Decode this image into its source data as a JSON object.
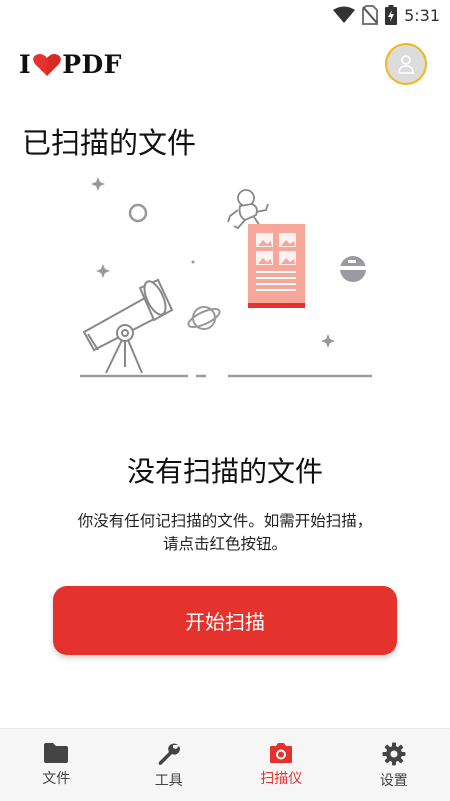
{
  "status_bar": {
    "time": "5:31"
  },
  "app": {
    "logo_text": "PDF",
    "logo_prefix": "I"
  },
  "page": {
    "title": "已扫描的文件"
  },
  "empty_state": {
    "title": "没有扫描的文件",
    "description_line1": "你没有任何记扫描的文件。如需开始扫描，",
    "description_line2": "请点击红色按钮。"
  },
  "actions": {
    "start_scan_label": "开始扫描"
  },
  "nav": {
    "items": [
      {
        "label": "文件",
        "icon": "folder-icon",
        "active": false
      },
      {
        "label": "工具",
        "icon": "wrench-icon",
        "active": false
      },
      {
        "label": "扫描仪",
        "icon": "camera-icon",
        "active": true
      },
      {
        "label": "设置",
        "icon": "gear-icon",
        "active": false
      }
    ]
  },
  "colors": {
    "accent": "#e5322d",
    "avatar_ring": "#f3b61f",
    "illustration_doc": "#f7a69a"
  }
}
